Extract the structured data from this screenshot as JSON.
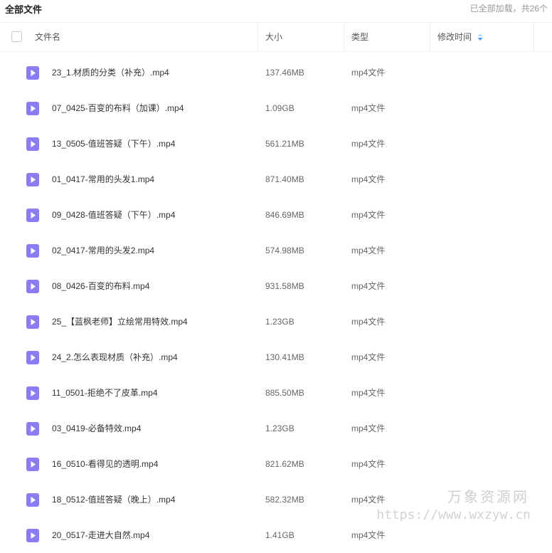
{
  "topbar": {
    "title": "全部文件",
    "status": "已全部加载，共26个"
  },
  "columns": {
    "name": "文件名",
    "size": "大小",
    "type": "类型",
    "modified": "修改时间"
  },
  "icons": {
    "video_icon_color": "#8b7cf6",
    "sort_icon_color": "#4a9cf2"
  },
  "files": [
    {
      "name": "23_1.材质的分类（补充）.mp4",
      "size": "137.46MB",
      "type": "mp4文件"
    },
    {
      "name": "07_0425-百变的布料（加课）.mp4",
      "size": "1.09GB",
      "type": "mp4文件"
    },
    {
      "name": "13_0505-值班答疑（下午）.mp4",
      "size": "561.21MB",
      "type": "mp4文件"
    },
    {
      "name": "01_0417-常用的头发1.mp4",
      "size": "871.40MB",
      "type": "mp4文件"
    },
    {
      "name": "09_0428-值班答疑（下午）.mp4",
      "size": "846.69MB",
      "type": "mp4文件"
    },
    {
      "name": "02_0417-常用的头发2.mp4",
      "size": "574.98MB",
      "type": "mp4文件"
    },
    {
      "name": "08_0426-百变的布料.mp4",
      "size": "931.58MB",
      "type": "mp4文件"
    },
    {
      "name": "25_【蓝枫老师】立绘常用特效.mp4",
      "size": "1.23GB",
      "type": "mp4文件"
    },
    {
      "name": "24_2.怎么表现材质（补充）.mp4",
      "size": "130.41MB",
      "type": "mp4文件"
    },
    {
      "name": "11_0501-拒绝不了皮革.mp4",
      "size": "885.50MB",
      "type": "mp4文件"
    },
    {
      "name": "03_0419-必备特效.mp4",
      "size": "1.23GB",
      "type": "mp4文件"
    },
    {
      "name": "16_0510-看得见的透明.mp4",
      "size": "821.62MB",
      "type": "mp4文件"
    },
    {
      "name": "18_0512-值班答疑（晚上）.mp4",
      "size": "582.32MB",
      "type": "mp4文件"
    },
    {
      "name": "20_0517-走进大自然.mp4",
      "size": "1.41GB",
      "type": "mp4文件"
    }
  ],
  "watermark": {
    "line1": "万象资源网",
    "line2": "https://www.wxzyw.cn"
  }
}
